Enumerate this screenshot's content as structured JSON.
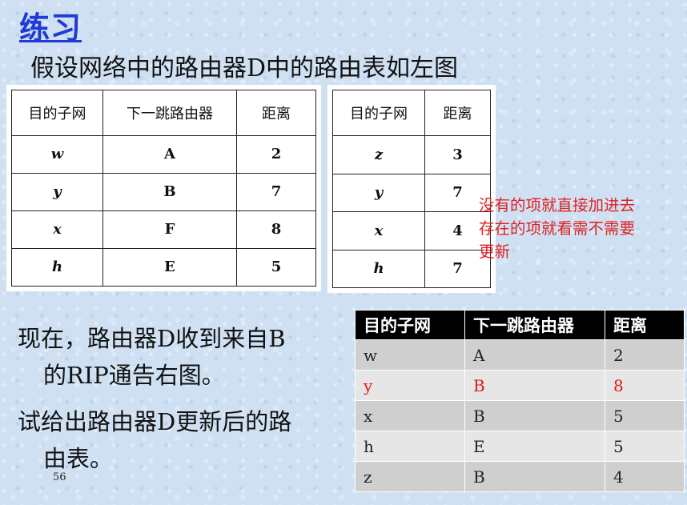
{
  "title": "练习",
  "subtitle": "假设网络中的路由器D中的路由表如左图",
  "router_table": {
    "headers": [
      "目的子网",
      "下一跳路由器",
      "距离"
    ],
    "rows": [
      [
        "w",
        "A",
        "2"
      ],
      [
        "y",
        "B",
        "7"
      ],
      [
        "x",
        "F",
        "8"
      ],
      [
        "h",
        "E",
        "5"
      ]
    ]
  },
  "advert_table": {
    "headers": [
      "目的子网",
      "距离"
    ],
    "rows": [
      [
        "z",
        "3"
      ],
      [
        "y",
        "7"
      ],
      [
        "x",
        "4"
      ],
      [
        "h",
        "7"
      ]
    ]
  },
  "note_lines": [
    "没有的项就直接加进去",
    "存在的项就看需不需要",
    "更新"
  ],
  "paragraph1": [
    "现在，路由器D收到来自B",
    "的RIP通告右图。"
  ],
  "paragraph2": [
    "试给出路由器D更新后的路",
    "由表。"
  ],
  "page_number": "56",
  "result_table": {
    "headers": [
      "目的子网",
      "下一跳路由器",
      "距离"
    ],
    "rows": [
      [
        "w",
        "A",
        "2"
      ],
      [
        "y",
        "B",
        "8"
      ],
      [
        "x",
        "B",
        "5"
      ],
      [
        "h",
        "E",
        "5"
      ],
      [
        "z",
        "B",
        "4"
      ]
    ],
    "highlight_color": "#e01818"
  }
}
